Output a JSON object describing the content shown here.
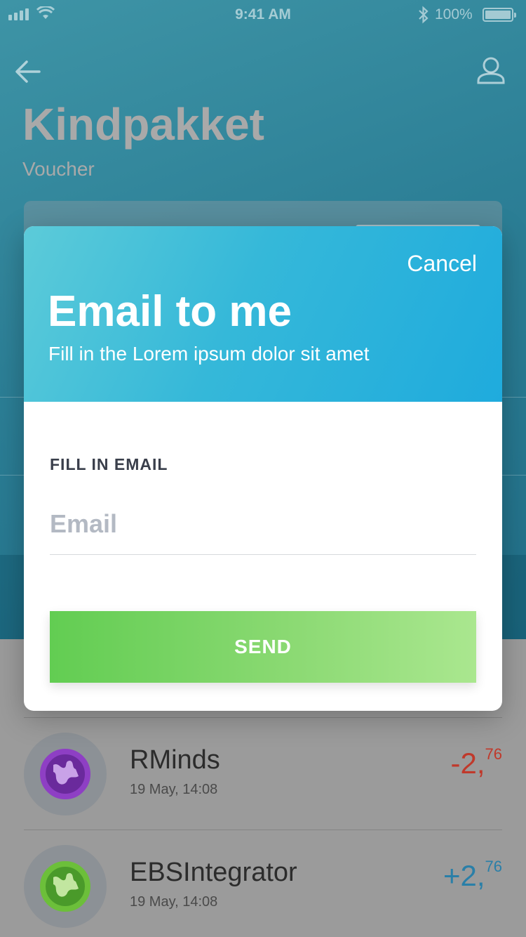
{
  "status_bar": {
    "time": "9:41 AM",
    "battery": "100%"
  },
  "header": {
    "title": "Kindpakket",
    "subtitle": "Voucher"
  },
  "transactions": [
    {
      "name": "RMinds",
      "date": "19 May, 14:08",
      "amount_main": "-2,",
      "amount_cents": "76",
      "color": "#c0392b",
      "icon_color": "#8e3fc4"
    },
    {
      "name": "EBSIntegrator",
      "date": "19 May, 14:08",
      "amount_main": "+2,",
      "amount_cents": "76",
      "color": "#2a7fa8",
      "icon_color": "#6cbf3a"
    }
  ],
  "modal": {
    "cancel_label": "Cancel",
    "title": "Email to me",
    "subtitle": "Fill in the Lorem ipsum dolor sit amet",
    "field_label": "FILL IN EMAIL",
    "email_placeholder": "Email",
    "email_value": "",
    "send_label": "SEND"
  }
}
